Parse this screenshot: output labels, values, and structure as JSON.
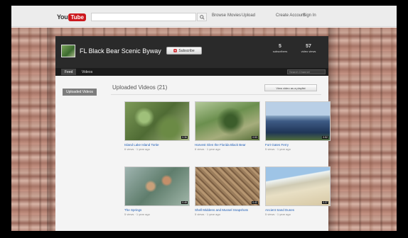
{
  "topbar": {
    "logo_you": "You",
    "logo_tube": "Tube",
    "search_value": "",
    "links": [
      "Browse",
      "Movies",
      "Upload"
    ],
    "create_account": "Create Account",
    "sign_in": "Sign In"
  },
  "channel": {
    "title": "FL Black Bear Scenic Byway",
    "subscribe_label": "Subscribe",
    "stats": [
      {
        "value": "5",
        "label": "subscribers"
      },
      {
        "value": "57",
        "label": "video views"
      }
    ]
  },
  "nav": {
    "tabs": [
      "Feed",
      "Videos"
    ],
    "active_tab": 0,
    "search_placeholder": "Search Channel"
  },
  "sidebar": {
    "button_label": "Uploaded Videos"
  },
  "main": {
    "section_title": "Uploaded Videos (21)",
    "view_all_label": "View video as a playlist",
    "videos": [
      {
        "title": "Island Lake Island Tortie",
        "meta": "6 views · 1 year ago",
        "duration": "0:36",
        "thumb": "forest-green"
      },
      {
        "title": "Harvest Glen the Florida Black Bear",
        "meta": "6 views · 1 year ago",
        "duration": "0:53",
        "thumb": "forest-brush"
      },
      {
        "title": "Fort Gates Ferry",
        "meta": "5 views · 1 year ago",
        "duration": "0:52",
        "thumb": "lake-water"
      },
      {
        "title": "The Springs",
        "meta": "5 views · 1 year ago",
        "duration": "0:48",
        "thumb": "springs-turtles"
      },
      {
        "title": "Shell Middens and Mussel Snapshots",
        "meta": "5 views · 1 year ago",
        "duration": "0:42",
        "thumb": "shell-ground"
      },
      {
        "title": "Ancient Sand Dunes",
        "meta": "5 views · 1 year ago",
        "duration": "0:37",
        "thumb": "sand-dune"
      }
    ]
  }
}
